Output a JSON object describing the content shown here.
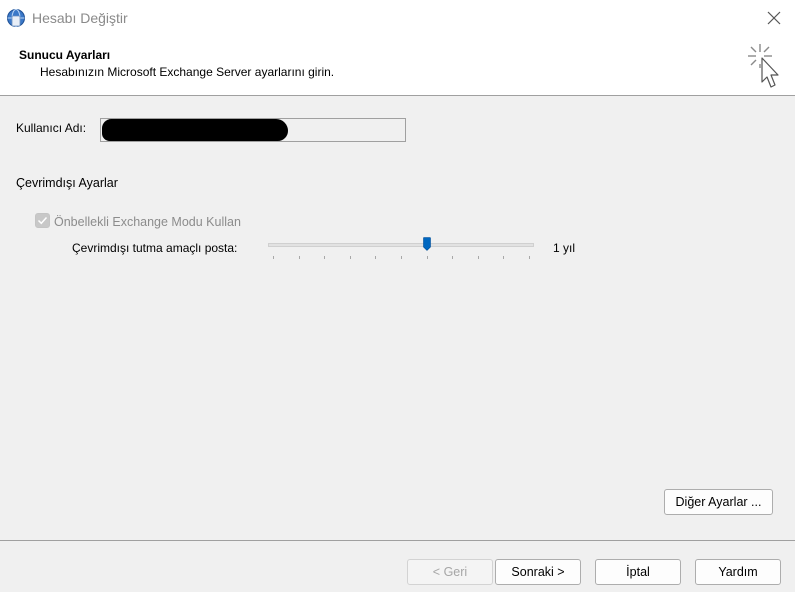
{
  "window": {
    "title": "Hesabı Değiştir",
    "close_icon": "close-icon",
    "app_icon": "outlook-profile-icon"
  },
  "header": {
    "title": "Sunucu Ayarları",
    "subtitle": "Hesabınızın Microsoft Exchange Server ayarlarını girin.",
    "icon": "wizard-sparkle-cursor-icon"
  },
  "form": {
    "username_label": "Kullanıcı Adı:",
    "username_value": "",
    "offline_heading": "Çevrimdışı Ayarlar",
    "cached_mode_label": "Önbellekli Exchange Modu Kullan",
    "cached_mode_checked": true,
    "cached_mode_enabled": false,
    "mail_to_keep_label": "Çevrimdışı tutma amaçlı posta:",
    "mail_to_keep_value": "1 yıl",
    "mail_to_keep_slider_fraction": 0.6
  },
  "buttons": {
    "more_settings": "Diğer Ayarlar ...",
    "back": "< Geri",
    "next": "Sonraki >",
    "cancel": "İptal",
    "help": "Yardım"
  },
  "colors": {
    "slider_thumb": "#0067c0",
    "background": "#f0f0f0",
    "header_background": "#ffffff"
  }
}
